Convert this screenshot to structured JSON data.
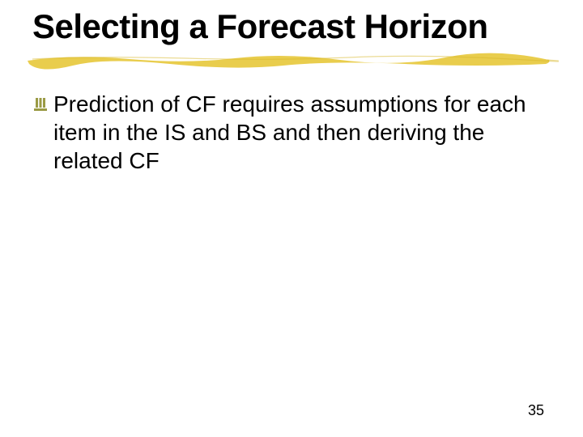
{
  "title": "Selecting a Forecast Horizon",
  "bullets": [
    {
      "text": "Prediction of CF requires assumptions for each item in the IS and BS and then deriving the related CF"
    }
  ],
  "page_number": "35",
  "accent_color": "#e7c93e",
  "bullet_color": "#9a9a44"
}
